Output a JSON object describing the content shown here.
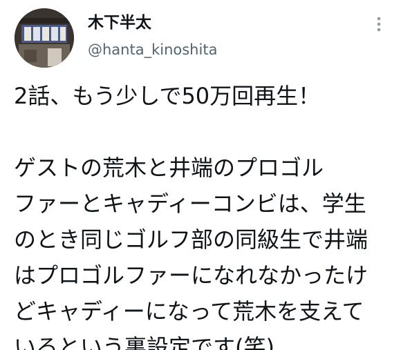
{
  "tweet": {
    "author": {
      "display_name": "木下半太",
      "handle": "@hanta_kinoshita",
      "avatar_icon": "avatar-photo-icon"
    },
    "more_icon": "more-vertical-icon",
    "text_lines": [
      "2話、もう少しで50万回再生！",
      "",
      "ゲストの荒木と井端のプロゴル",
      "ファーとキャディーコンビは、学生",
      "のとき同じゴルフ部の同級生で井端",
      "はプロゴルファーになれなかったけ",
      "どキャディーになって荒木を支えて",
      "いるという裏設定です(笑)"
    ]
  }
}
